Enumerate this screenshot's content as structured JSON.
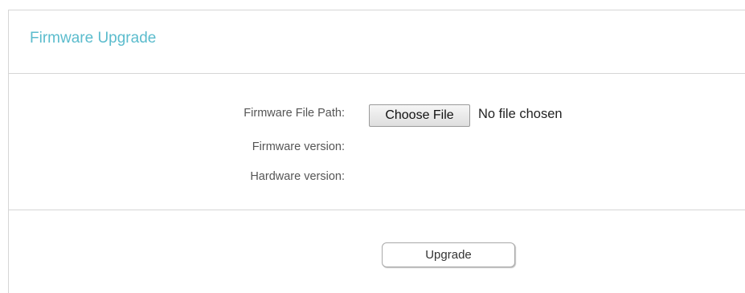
{
  "page": {
    "title": "Firmware Upgrade"
  },
  "form": {
    "file_path_label": "Firmware File Path:",
    "choose_file_label": "Choose File",
    "no_file_text": "No file chosen",
    "firmware_version_label": "Firmware version:",
    "firmware_version_value": "",
    "hardware_version_label": "Hardware version:",
    "hardware_version_value": ""
  },
  "actions": {
    "upgrade_label": "Upgrade"
  },
  "colors": {
    "title": "#5bbccd",
    "divider": "#d6d6d6",
    "label": "#555555"
  }
}
